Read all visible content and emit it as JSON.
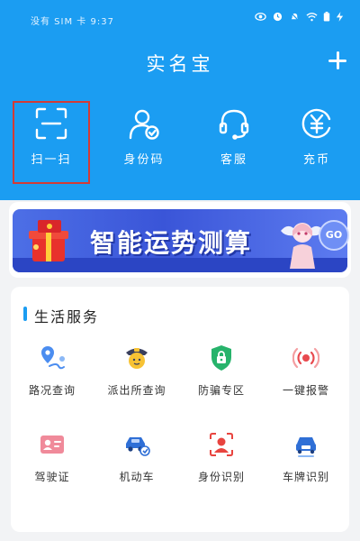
{
  "status": {
    "carrier": "没有 SIM 卡",
    "time": "9:37"
  },
  "header": {
    "title": "实名宝"
  },
  "quick_actions": [
    {
      "label": "扫一扫",
      "icon": "scan-icon"
    },
    {
      "label": "身份码",
      "icon": "id-code-icon"
    },
    {
      "label": "客服",
      "icon": "headset-icon"
    },
    {
      "label": "充币",
      "icon": "yuan-coin-icon"
    }
  ],
  "banner": {
    "text": "智能运势测算",
    "go_label": "GO"
  },
  "life_services": {
    "title": "生活服务",
    "items": [
      {
        "label": "路况查询",
        "icon": "map-pin-route-icon"
      },
      {
        "label": "派出所查询",
        "icon": "police-officer-icon"
      },
      {
        "label": "防骗专区",
        "icon": "shield-lock-icon"
      },
      {
        "label": "一键报警",
        "icon": "alarm-broadcast-icon"
      },
      {
        "label": "驾驶证",
        "icon": "driver-license-icon"
      },
      {
        "label": "机动车",
        "icon": "car-icon"
      },
      {
        "label": "身份识别",
        "icon": "face-id-icon"
      },
      {
        "label": "车牌识别",
        "icon": "plate-recognition-icon"
      }
    ]
  },
  "colors": {
    "primary": "#1b9df2",
    "highlight": "#d33b36"
  }
}
